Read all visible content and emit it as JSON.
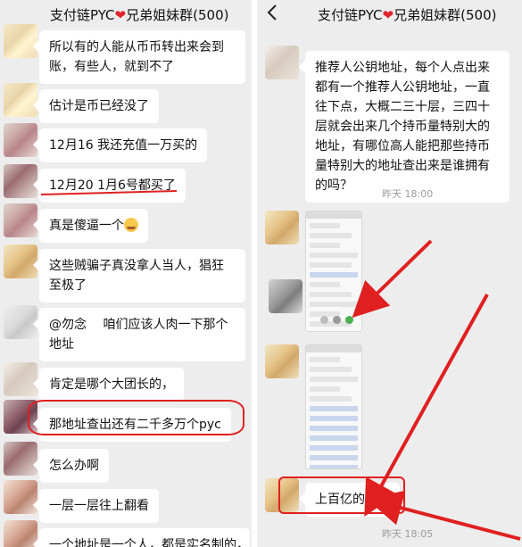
{
  "left_panel": {
    "title_prefix": "支付链PYC",
    "title_heart": "❤",
    "title_suffix": "兄弟姐妹群(500)",
    "messages": [
      {
        "text": "所以有的人能从币币转出来会到账，有些人，就到不了"
      },
      {
        "text": "估计是币已经没了"
      },
      {
        "text": "12月16 我还充值一万买的"
      },
      {
        "text": "12月20 1月6号都买了"
      },
      {
        "text": "真是傻逼一个",
        "emoji": "😭"
      },
      {
        "text": "这些贼骗子真没拿人当人，猖狂至极了"
      },
      {
        "text": "@勿念　 咱们应该人肉一下那个地址"
      },
      {
        "text": "肯定是哪个大团长的，"
      },
      {
        "text": "那地址查出还有二千多万个pyc"
      },
      {
        "text": "怎么办啊"
      },
      {
        "text": "一层一层往上翻看"
      },
      {
        "text": "一个地址是一个人，都是实名制的，"
      }
    ]
  },
  "right_panel": {
    "back_icon": "chevron-left-icon",
    "title_prefix": "支付链PYC",
    "title_heart": "❤",
    "title_suffix": "兄弟姐妹群(500)",
    "message_1": "推荐人公钥地址，每个人点出来都有一个推荐人公钥地址，一直往下点，大概二三十层，三四十层就会出来几个持币量特别大的地址，有哪位高人能把那些持币量特别大的地址查出来是谁拥有的吗？",
    "time_1": "昨天 18:00",
    "image_1": "screenshot-thumbnail",
    "image_2": "screenshot-thumbnail",
    "message_2": "上百亿的资金",
    "time_2": "昨天 18:05"
  },
  "colors": {
    "chat_background": "#ededed",
    "bubble": "#ffffff",
    "annotation_red": "#e02020",
    "heart": "#e0242c"
  }
}
